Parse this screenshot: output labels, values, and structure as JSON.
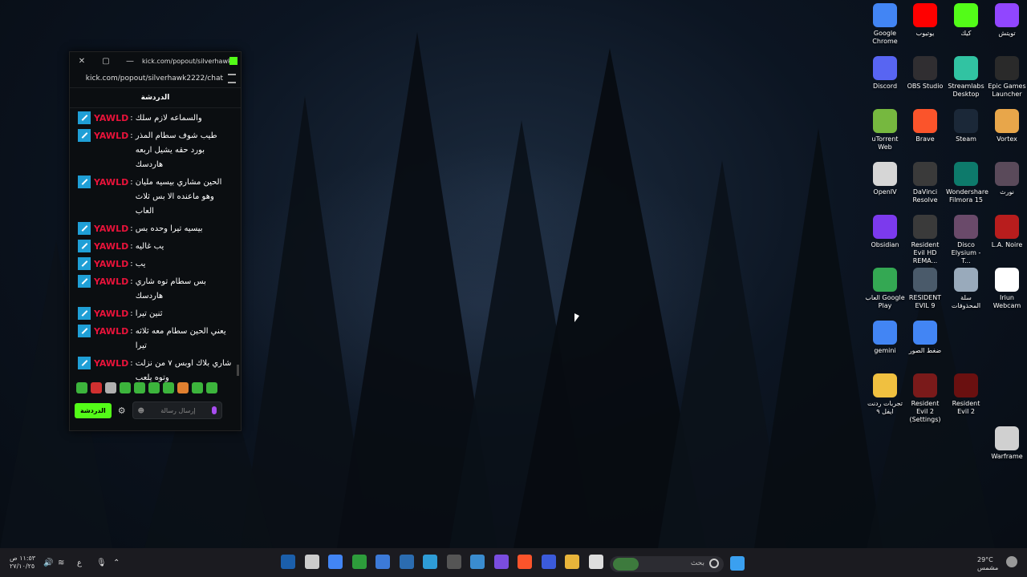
{
  "window": {
    "title": "kick.com/popout/silverhawk...",
    "url": "kick.com/popout/silverhawk2222/chat",
    "close": "✕",
    "maximize": "▢",
    "minimize": "—"
  },
  "chat": {
    "header": "الدردشة",
    "messages": [
      {
        "user": "YAWLD",
        "text": "والسماعه لازم سلك"
      },
      {
        "user": "YAWLD",
        "text": "طيب شوف سطام المذر بورد حقه يشيل اربعه هاردسك"
      },
      {
        "user": "YAWLD",
        "text": "الحين مشاري بيسيه مليان وهو ماعنده الا بس ثلاث العاب"
      },
      {
        "user": "YAWLD",
        "text": "بيسيه تيرا وحده بس"
      },
      {
        "user": "YAWLD",
        "text": "يب غاليه"
      },
      {
        "user": "YAWLD",
        "text": "يب"
      },
      {
        "user": "YAWLD",
        "text": "بس سطام توه شاري هاردسك"
      },
      {
        "user": "YAWLD",
        "text": "ثنين تيرا"
      },
      {
        "user": "YAWLD",
        "text": "يعني الحين سطام معه ثلاثه تيرا"
      },
      {
        "user": "YAWLD",
        "text": "شاري بلاك اوبس ٧ من نزلت وتوه يلعب"
      }
    ],
    "send_label": "الدردشة",
    "input_placeholder": "إرسال رسالة",
    "emote_colors": [
      "#3cb43c",
      "#d03030",
      "#b0b0b0",
      "#3cb43c",
      "#3cb43c",
      "#3cb43c",
      "#3cb43c",
      "#e08030",
      "#3cb43c",
      "#3cb43c"
    ]
  },
  "desktop_icons": [
    {
      "label": "Google Chrome",
      "color": "#4285f4"
    },
    {
      "label": "يوتيوب",
      "color": "#ff0000"
    },
    {
      "label": "كيك",
      "color": "#53fc18"
    },
    {
      "label": "تويتش",
      "color": "#9146ff"
    },
    {
      "label": "Discord",
      "color": "#5865f2"
    },
    {
      "label": "OBS Studio",
      "color": "#302e31"
    },
    {
      "label": "Streamlabs Desktop",
      "color": "#31c3a2"
    },
    {
      "label": "Epic Games Launcher",
      "color": "#2a2a2a"
    },
    {
      "label": "uTorrent Web",
      "color": "#76b83f"
    },
    {
      "label": "Brave",
      "color": "#fb542b"
    },
    {
      "label": "Steam",
      "color": "#1b2838"
    },
    {
      "label": "Vortex",
      "color": "#e8a64a"
    },
    {
      "label": "OpenIV",
      "color": "#d6d6d6"
    },
    {
      "label": "DaVinci Resolve",
      "color": "#3a3a3a"
    },
    {
      "label": "Wondershare Filmora 15",
      "color": "#0d7a6b"
    },
    {
      "label": "نورث",
      "color": "#5a4a5a"
    },
    {
      "label": "Obsidian",
      "color": "#7c3aed"
    },
    {
      "label": "Resident Evil HD REMA...",
      "color": "#3a3a3a"
    },
    {
      "label": "Disco Elysium - T...",
      "color": "#6a4a6a"
    },
    {
      "label": "L.A. Noire",
      "color": "#b81d1d"
    },
    {
      "label": "العاب Google Play",
      "color": "#34a853"
    },
    {
      "label": "RESIDENT EVIL 9",
      "color": "#4a5a6a"
    },
    {
      "label": "سلة المحذوفات",
      "color": "#9ab"
    },
    {
      "label": "Iriun Webcam",
      "color": "#ffffff"
    },
    {
      "label": "gemini",
      "color": "#4285f4"
    },
    {
      "label": "ضغط الصور",
      "color": "#4285f4"
    },
    {
      "label": "تجربات ردنت ايفل ٩",
      "color": "#f0c040"
    },
    {
      "label": "Resident Evil 2 (Settings)",
      "color": "#7a1a1a"
    },
    {
      "label": "Resident Evil 2",
      "color": "#6a1010"
    },
    {
      "label": "Warframe",
      "color": "#d0d0d0"
    }
  ],
  "taskbar": {
    "search_placeholder": "بحث",
    "weather_temp": "29°C",
    "weather_desc": "مشمس",
    "time": "١١:٥٣ ص",
    "date": "٢٧/١٠/٢٥",
    "lang": "ع",
    "app_colors": [
      "#1b5fab",
      "#cccccc",
      "#4285f4",
      "#2d9c3b",
      "#3c7ad8",
      "#2b6cb0",
      "#2e9cd6",
      "#555555",
      "#3a8ccf",
      "#7a4ddf",
      "#fb542b",
      "#3b5bdb",
      "#e8b43a",
      "#dddddd"
    ]
  }
}
